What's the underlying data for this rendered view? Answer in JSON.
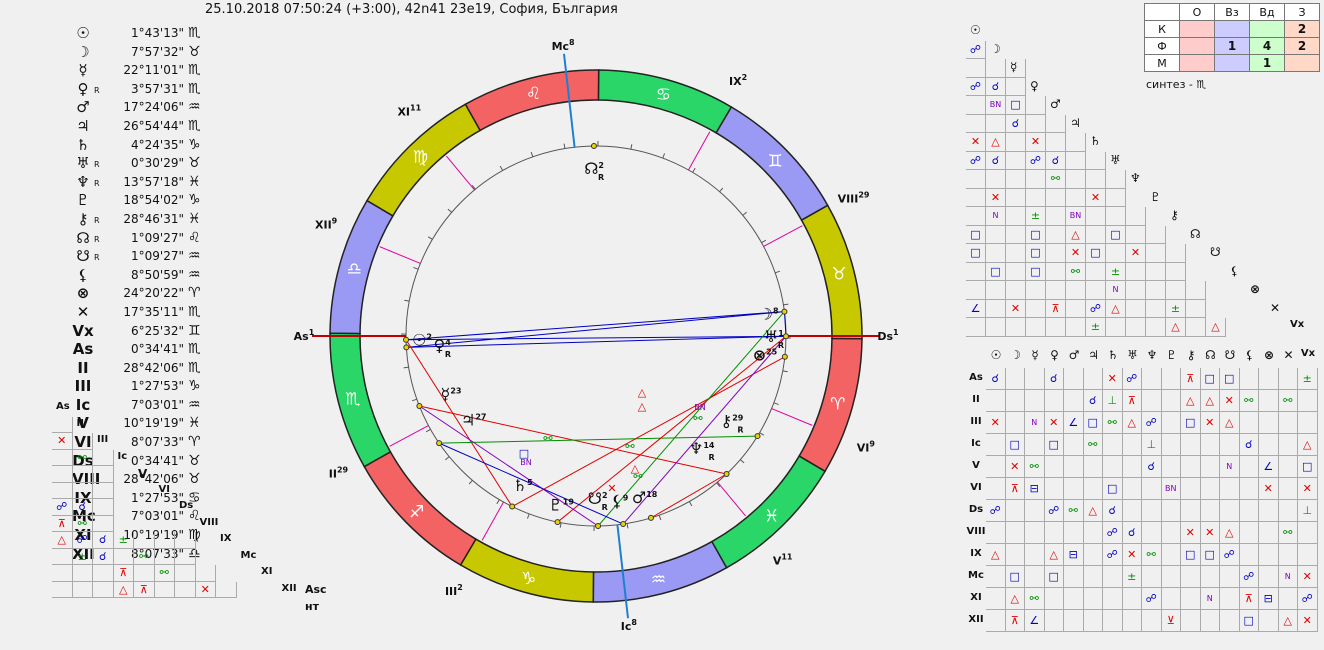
{
  "header": "25.10.2018 07:50:24 (+3:00), 42n41 23e19, София, България",
  "colors": {
    "fire": "#f46363",
    "earth": "#c8c800",
    "air": "#9a9af5",
    "water": "#2bd669",
    "axis_red": "#c00000",
    "axis_blue": "#1e7fd0",
    "aspect_red": "#e00000",
    "aspect_blue": "#0000c0",
    "aspect_green": "#009000",
    "aspect_purple": "#8000c0",
    "house_line": "#e000a0"
  },
  "planets": [
    {
      "glyph": "☉",
      "retro": "",
      "deg": "1°43'13\"",
      "sign": "♏"
    },
    {
      "glyph": "☽",
      "retro": "",
      "deg": "7°57'32\"",
      "sign": "♉"
    },
    {
      "glyph": "☿",
      "retro": "",
      "deg": "22°11'01\"",
      "sign": "♏"
    },
    {
      "glyph": "♀",
      "retro": "R",
      "deg": "3°57'31\"",
      "sign": "♏"
    },
    {
      "glyph": "♂",
      "retro": "",
      "deg": "17°24'06\"",
      "sign": "♒"
    },
    {
      "glyph": "♃",
      "retro": "",
      "deg": "26°54'44\"",
      "sign": "♏"
    },
    {
      "glyph": "♄",
      "retro": "",
      "deg": "4°24'35\"",
      "sign": "♑"
    },
    {
      "glyph": "♅",
      "retro": "R",
      "deg": "0°30'29\"",
      "sign": "♉"
    },
    {
      "glyph": "♆",
      "retro": "R",
      "deg": "13°57'18\"",
      "sign": "♓"
    },
    {
      "glyph": "♇",
      "retro": "",
      "deg": "18°54'02\"",
      "sign": "♑"
    },
    {
      "glyph": "⚷",
      "retro": "R",
      "deg": "28°46'31\"",
      "sign": "♓"
    },
    {
      "glyph": "☊",
      "retro": "R",
      "deg": "1°09'27\"",
      "sign": "♌"
    },
    {
      "glyph": "☋",
      "retro": "R",
      "deg": "1°09'27\"",
      "sign": "♒"
    },
    {
      "glyph": "⚸",
      "retro": "",
      "deg": "8°50'59\"",
      "sign": "♒"
    },
    {
      "glyph": "⊗",
      "retro": "",
      "deg": "24°20'22\"",
      "sign": "♈"
    },
    {
      "glyph": "✕",
      "retro": "",
      "deg": "17°35'11\"",
      "sign": "♏"
    },
    {
      "glyph": "Vx",
      "retro": "",
      "deg": "6°25'32\"",
      "sign": "♊"
    },
    {
      "glyph": "As",
      "retro": "",
      "deg": "0°34'41\"",
      "sign": "♏"
    },
    {
      "glyph": "II",
      "retro": "",
      "deg": "28°42'06\"",
      "sign": "♏"
    },
    {
      "glyph": "III",
      "retro": "",
      "deg": "1°27'53\"",
      "sign": "♑"
    },
    {
      "glyph": "Ic",
      "retro": "",
      "deg": "7°03'01\"",
      "sign": "♒"
    },
    {
      "glyph": "V",
      "retro": "",
      "deg": "10°19'19\"",
      "sign": "♓"
    },
    {
      "glyph": "VI",
      "retro": "",
      "deg": "8°07'33\"",
      "sign": "♈"
    },
    {
      "glyph": "Ds",
      "retro": "",
      "deg": "0°34'41\"",
      "sign": "♉"
    },
    {
      "glyph": "VIII",
      "retro": "",
      "deg": "28°42'06\"",
      "sign": "♉"
    },
    {
      "glyph": "IX",
      "retro": "",
      "deg": "1°27'53\"",
      "sign": "♋"
    },
    {
      "glyph": "Mc",
      "retro": "",
      "deg": "7°03'01\"",
      "sign": "♌"
    },
    {
      "glyph": "XI",
      "retro": "",
      "deg": "10°19'19\"",
      "sign": "♍"
    },
    {
      "glyph": "XII",
      "retro": "",
      "deg": "8°07'33\"",
      "sign": "♎"
    }
  ],
  "quality_table": {
    "cols": [
      "",
      "О",
      "Вз",
      "Вд",
      "З"
    ],
    "rows": [
      {
        "label": "К",
        "vals": [
          "",
          "",
          "",
          "2"
        ]
      },
      {
        "label": "Ф",
        "vals": [
          "",
          "1",
          "4",
          "2"
        ]
      },
      {
        "label": "М",
        "vals": [
          "",
          "",
          "1",
          ""
        ]
      }
    ]
  },
  "synthesis": "синтез - ♏",
  "wheel": {
    "signs": [
      "♈",
      "♉",
      "♊",
      "♋",
      "♌",
      "♍",
      "♎",
      "♏",
      "♐",
      "♑",
      "♒",
      "♓"
    ],
    "houses": [
      {
        "label": "As",
        "sup": "1"
      },
      {
        "label": "II",
        "sup": "29"
      },
      {
        "label": "III",
        "sup": "2"
      },
      {
        "label": "Ic",
        "sup": "8"
      },
      {
        "label": "V",
        "sup": "11"
      },
      {
        "label": "VI",
        "sup": "9"
      },
      {
        "label": "Ds",
        "sup": "1"
      },
      {
        "label": "VIII",
        "sup": "29"
      },
      {
        "label": "IX",
        "sup": "2"
      },
      {
        "label": "Mc",
        "sup": "8"
      },
      {
        "label": "XI",
        "sup": "11"
      },
      {
        "label": "XII",
        "sup": "9"
      }
    ],
    "points": [
      {
        "glyph": "☉",
        "deg": "2",
        "retro": ""
      },
      {
        "glyph": "♀",
        "deg": "4",
        "retro": "R"
      },
      {
        "glyph": "☿",
        "deg": "23",
        "retro": ""
      },
      {
        "glyph": "♃",
        "deg": "27",
        "retro": ""
      },
      {
        "glyph": "♄",
        "deg": "5",
        "retro": ""
      },
      {
        "glyph": "♇",
        "deg": "19",
        "retro": ""
      },
      {
        "glyph": "☋",
        "deg": "2",
        "retro": "R"
      },
      {
        "glyph": "⚸",
        "deg": "9",
        "retro": ""
      },
      {
        "glyph": "♂",
        "deg": "18",
        "retro": ""
      },
      {
        "glyph": "♆",
        "deg": "14",
        "retro": "R"
      },
      {
        "glyph": "⚷",
        "deg": "29",
        "retro": "R"
      },
      {
        "glyph": "⊗",
        "deg": "25",
        "retro": ""
      },
      {
        "glyph": "♅",
        "deg": "1",
        "retro": "R"
      },
      {
        "glyph": "☽",
        "deg": "8",
        "retro": ""
      },
      {
        "glyph": "☊",
        "deg": "2",
        "retro": "R"
      }
    ],
    "aspect_marks": [
      "△",
      "△",
      "△",
      "✕",
      "BN",
      "BN",
      "□",
      "⚯",
      "⚯",
      "⚯",
      "⚯"
    ]
  },
  "planet_triangle": {
    "glyphs": [
      "☉",
      "☽",
      "☿",
      "♀",
      "♂",
      "♃",
      "♄",
      "♅",
      "♆",
      "♇",
      "⚷",
      "☊",
      "☋",
      "⚸",
      "⊗",
      "✕",
      "Vx"
    ],
    "rows": [
      [],
      [
        "☍"
      ],
      [
        "",
        "",
        ""
      ],
      [
        "☍",
        "☌",
        ""
      ],
      [
        "",
        "BN",
        "□",
        ""
      ],
      [
        "",
        "",
        "☌",
        "",
        ""
      ],
      [
        "✕",
        "△",
        "",
        "✕",
        "",
        ""
      ],
      [
        "☍",
        "☌",
        "",
        "☍",
        "☌",
        "",
        ""
      ],
      [
        "",
        "",
        "",
        "",
        "⚯",
        "",
        "",
        ""
      ],
      [
        "",
        "✕",
        "",
        "",
        "",
        "",
        "✕",
        ""
      ],
      [
        "",
        "N",
        "",
        "±",
        "",
        "BN",
        "",
        "",
        ""
      ],
      [
        "□",
        "",
        "",
        "□",
        "",
        "△",
        "",
        "□",
        "",
        ""
      ],
      [
        "□",
        "",
        "",
        "□",
        "",
        "✕",
        "□",
        "",
        "✕",
        "",
        ""
      ],
      [
        "",
        "□",
        "",
        "□",
        "",
        "⚯",
        "",
        "±",
        "",
        "",
        ""
      ],
      [
        "",
        "",
        "",
        "",
        "",
        "",
        "",
        "N",
        "",
        "",
        "",
        ""
      ],
      [
        "∠",
        "",
        "✕",
        "",
        "⊼",
        "",
        "☍",
        "△",
        "",
        "",
        "±",
        ""
      ],
      [
        "",
        "",
        "",
        "",
        "",
        "",
        "±",
        "",
        "",
        "",
        "△",
        "",
        "△"
      ]
    ]
  },
  "house_grid": {
    "cols": [
      "☉",
      "☽",
      "☿",
      "♀",
      "♂",
      "♃",
      "♄",
      "♅",
      "♆",
      "♇",
      "⚷",
      "☊",
      "☋",
      "⚸",
      "⊗",
      "✕",
      "Vx"
    ],
    "rows": [
      {
        "label": "As",
        "cells": [
          "☌",
          "",
          "",
          "☌",
          "",
          "",
          "✕",
          "☍",
          "",
          "",
          "⊼",
          "□",
          "□",
          "",
          "",
          "",
          "±"
        ]
      },
      {
        "label": "II",
        "cells": [
          "",
          "",
          "",
          "",
          "",
          "☌",
          "⊥",
          "⊼",
          "",
          "",
          "△",
          "△",
          "✕",
          "⚯",
          "",
          "⚯",
          ""
        ]
      },
      {
        "label": "III",
        "cells": [
          "✕",
          "",
          "N",
          "✕",
          "∠",
          "□",
          "⚯",
          "△",
          "☍",
          "",
          "□",
          "✕",
          "△",
          "",
          "",
          "",
          ""
        ]
      },
      {
        "label": "Ic",
        "cells": [
          "",
          "□",
          "",
          "□",
          "",
          "⚯",
          "",
          "",
          "⊥",
          "",
          "",
          "",
          "",
          "☌",
          "",
          "",
          "△"
        ]
      },
      {
        "label": "V",
        "cells": [
          "",
          "✕",
          "⚯",
          "",
          "",
          "",
          "",
          "",
          "☌",
          "",
          "",
          "",
          "N",
          "",
          "∠",
          "",
          "□"
        ]
      },
      {
        "label": "VI",
        "cells": [
          "",
          "⊼",
          "⊟",
          "",
          "",
          "",
          "□",
          "",
          "",
          "BN",
          "",
          "",
          "",
          "",
          "✕",
          "",
          "✕"
        ]
      },
      {
        "label": "Ds",
        "cells": [
          "☍",
          "",
          "",
          "☍",
          "⚯",
          "△",
          "☌",
          "",
          "",
          "",
          "",
          "",
          "",
          "",
          "",
          "",
          "⊥"
        ]
      },
      {
        "label": "VIII",
        "cells": [
          "",
          "",
          "",
          "",
          "",
          "",
          "☍",
          "☌",
          "",
          "",
          "✕",
          "✕",
          "△",
          "",
          "",
          "⚯",
          ""
        ]
      },
      {
        "label": "IX",
        "cells": [
          "△",
          "",
          "",
          "△",
          "⊟",
          "",
          "☍",
          "✕",
          "⚯",
          "",
          "□",
          "□",
          "☍",
          "",
          "",
          "",
          ""
        ]
      },
      {
        "label": "Mc",
        "cells": [
          "",
          "□",
          "",
          "□",
          "",
          "",
          "",
          "±",
          "",
          "",
          "",
          "",
          "",
          "☍",
          "",
          "N",
          "✕"
        ]
      },
      {
        "label": "XI",
        "cells": [
          "",
          "△",
          "⚯",
          "",
          "",
          "",
          "",
          "",
          "☍",
          "",
          "",
          "N",
          "",
          "⊼",
          "⊟",
          "",
          "☍"
        ]
      },
      {
        "label": "XII",
        "cells": [
          "",
          "⊼",
          "∠",
          "",
          "",
          "",
          "",
          "",
          "",
          "⊻",
          "",
          "",
          "",
          "□",
          "",
          "△",
          "✕"
        ]
      }
    ]
  },
  "left_triangle": {
    "glyphs": [
      "As",
      "II",
      "III",
      "Ic",
      "V",
      "VI",
      "Ds",
      "VIII",
      "IX",
      "Mc",
      "XI",
      "XII"
    ],
    "rows": [
      [],
      [
        ""
      ],
      [
        "✕",
        ""
      ],
      [
        "",
        "⚯",
        ""
      ],
      [
        "",
        "",
        ""
      ],
      [
        "",
        "",
        ""
      ],
      [
        "☍",
        "☌",
        ""
      ],
      [
        "⊼",
        "⚯",
        ""
      ],
      [
        "△",
        "☍",
        "☌",
        "±",
        "",
        "",
        ""
      ],
      [
        "",
        "±",
        "☌",
        "",
        "⚯",
        "",
        ""
      ],
      [
        "",
        "",
        "",
        "⊼",
        "",
        "⚯",
        "",
        ""
      ],
      [
        "",
        "",
        "",
        "△",
        "⊼",
        "",
        "",
        "✕",
        ""
      ]
    ]
  },
  "labels": {
    "asc": "Asc",
    "nt": "нт"
  }
}
